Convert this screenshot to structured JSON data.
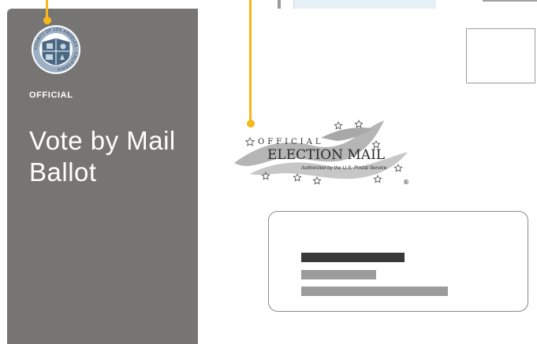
{
  "sidebar": {
    "official_label": "OFFICIAL",
    "title": "Vote by Mail Ballot"
  },
  "seal": {
    "ring_text": "COUNTY OF LOS ANGELES · CALIFORNIA"
  },
  "election_mail": {
    "line1": "OFFICIAL",
    "line2": "ELECTION MAIL",
    "authorized": "Authorized by the U.S. Postal Service",
    "registered": "®"
  },
  "colors": {
    "sidebar": "#777574",
    "accent": "#f5b71a",
    "address_dark": "#3a3939",
    "address_light": "#9c9b9c"
  },
  "icons": [
    "county-seal-icon",
    "election-mail-logo-icon",
    "callout-marker-icon"
  ]
}
